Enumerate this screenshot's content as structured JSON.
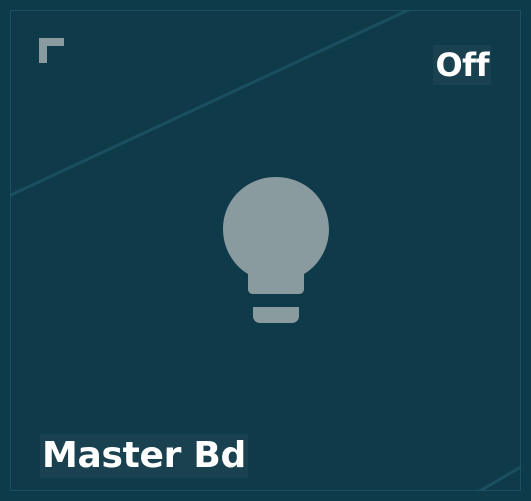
{
  "tile": {
    "name": "Master Bd",
    "state": "Off",
    "icon": "lightbulb-icon",
    "corner_icon": "corner-bracket-icon"
  },
  "colors": {
    "background": "#0f3a4a",
    "icon": "#8a9ba0",
    "text": "#ffffff",
    "label_bg": "#19414f"
  }
}
